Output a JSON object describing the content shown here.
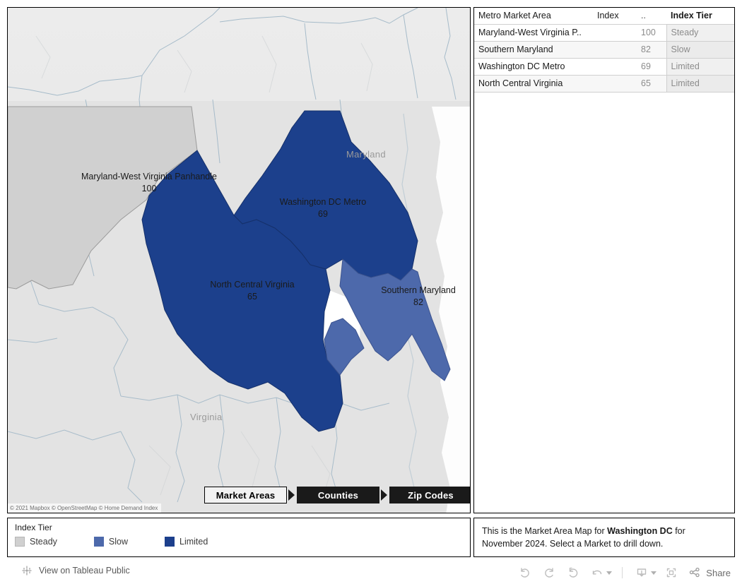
{
  "map": {
    "attribution": "© 2021 Mapbox © OpenStreetMap © Home Demand Index",
    "basemap_labels": [
      {
        "name": "maryland",
        "text": "Maryland"
      },
      {
        "name": "virginia",
        "text": "Virginia"
      }
    ],
    "regions": [
      {
        "name": "maryland-west-virginia-panhandle",
        "label": "Maryland-West Virginia Panhandle",
        "value": "100",
        "tier": "Steady",
        "color": "#d0d0d0"
      },
      {
        "name": "washington-dc-metro",
        "label": "Washington DC Metro",
        "value": "69",
        "tier": "Limited",
        "color": "#1c408c"
      },
      {
        "name": "north-central-virginia",
        "label": "North Central Virginia",
        "value": "65",
        "tier": "Limited",
        "color": "#1c408c"
      },
      {
        "name": "southern-maryland",
        "label": "Southern Maryland",
        "value": "82",
        "tier": "Slow",
        "color": "#4d69ab"
      }
    ],
    "drill_nav": [
      {
        "name": "market-areas",
        "label": "Market Areas",
        "state": "active"
      },
      {
        "name": "counties",
        "label": "Counties",
        "state": "idle"
      },
      {
        "name": "zip-codes",
        "label": "Zip Codes",
        "state": "idle"
      }
    ]
  },
  "legend": {
    "title": "Index Tier",
    "items": [
      {
        "label": "Steady",
        "color": "#d0d0d0"
      },
      {
        "label": "Slow",
        "color": "#4d69ab"
      },
      {
        "label": "Limited",
        "color": "#1c3f8c"
      }
    ]
  },
  "table": {
    "columns": {
      "name": "Metro Market Area",
      "index": "Index",
      "dots": "..",
      "tier": "Index Tier"
    },
    "rows": [
      {
        "name": "Maryland-West Virginia P..",
        "index": "100",
        "tier": "Steady"
      },
      {
        "name": "Southern Maryland",
        "index": "82",
        "tier": "Slow"
      },
      {
        "name": "Washington DC Metro",
        "index": "69",
        "tier": "Limited"
      },
      {
        "name": "North Central Virginia",
        "index": "65",
        "tier": "Limited"
      }
    ]
  },
  "caption": {
    "before": "This is the Market Area Map for ",
    "bold": "Washington DC",
    "after": " for November 2024.  Select a Market to drill down."
  },
  "bottom_bar": {
    "tableau_link": "View on Tableau Public",
    "share_label": "Share",
    "tools": [
      {
        "name": "undo",
        "title": "Undo"
      },
      {
        "name": "redo",
        "title": "Redo"
      },
      {
        "name": "revert",
        "title": "Revert"
      },
      {
        "name": "refresh",
        "title": "Refresh"
      },
      {
        "name": "download",
        "title": "Download"
      },
      {
        "name": "fullscreen",
        "title": "Full Screen"
      },
      {
        "name": "share",
        "title": "Share"
      }
    ]
  }
}
